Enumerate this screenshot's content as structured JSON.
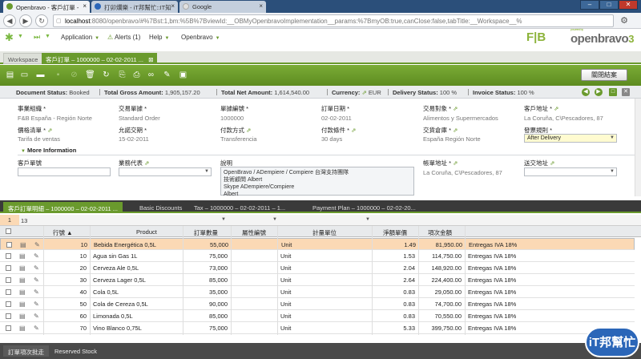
{
  "browser": {
    "tabs": [
      {
        "label": "Openbravo - 客戶訂單 -",
        "active": true
      },
      {
        "label": "打卯爛樂 - iT邦幫忙::IT知",
        "active": false
      },
      {
        "label": "Google",
        "active": false
      }
    ],
    "url_host": "localhost",
    "url_rest": ":8080/openbravo/#%7Bst:1,bm:%5B%7BviewId:__OBMyOpenbravoImplementation__params:%7BmyOB:true,canClose:false,tabTitle:__Workspace__%",
    "window_controls": [
      "–",
      "□",
      "✕"
    ]
  },
  "menu": {
    "items": [
      "Application",
      "Alerts (1)",
      "Help",
      "Openbravo"
    ]
  },
  "logo": {
    "left": "F|B",
    "right": "openbravo",
    "tagline": "powered by",
    "version": "3"
  },
  "window_tabs": [
    {
      "label": "Workspace",
      "active": false
    },
    {
      "label": "客戶訂單 – 1000000 – 02-02-2011 ...",
      "active": true
    }
  ],
  "toolbar": {
    "save_label": "關閉結案"
  },
  "status": {
    "doc_status_label": "Document Status:",
    "doc_status": "Booked",
    "gross_label": "Total Gross Amount:",
    "gross": "1,905,157.20",
    "net_label": "Total Net Amount:",
    "net": "1,614,540.00",
    "currency_label": "Currency:",
    "currency": "EUR",
    "delivery_label": "Delivery Status:",
    "delivery": "100 %",
    "invoice_label": "Invoice Status:",
    "invoice": "100 %"
  },
  "form": {
    "org_label": "事業組織",
    "org": "F&B España - Región Norte",
    "doctype_label": "交易單據",
    "doctype": "Standard Order",
    "docno_label": "單據編號",
    "docno": "1000000",
    "orderdate_label": "訂單日期",
    "orderdate": "02-02-2011",
    "bp_label": "交易對象",
    "bp": "Alimentos y Supermercados",
    "bpaddr_label": "客戶地址",
    "bpaddr": "La Coruña, C\\Pescadores, 87",
    "pricelist_label": "價格清單",
    "pricelist": "Tarifa de ventas",
    "delivdate_label": "允諾交期",
    "delivdate": "15-02-2011",
    "payment_label": "付款方式",
    "payment": "Transferencia",
    "payterm_label": "付款條件",
    "payterm": "30 days",
    "warehouse_label": "交貨倉庫",
    "warehouse": "España Región Norte",
    "invrule_label": "發票規則",
    "invrule": "After Delivery",
    "more_info": "More Information",
    "custref_label": "客戶單號",
    "salesrep_label": "業務代表",
    "desc_label": "說明",
    "desc_lines": [
      "OpenBravo / ADempiere / Compiere 台灣支持團隊",
      "技術顧問 Albert",
      "Skype ADempiere/Compiere",
      "Albert"
    ],
    "invaddr_label": "帳單地址",
    "invaddr": "La Coruña, C\\Pescadores, 87",
    "deladdr_label": "送交地址"
  },
  "subtabs": [
    {
      "label": "客戶訂單明細 – 1000000 – 02-02-2011 ...",
      "active": true
    },
    {
      "label": "Basic Discounts",
      "active": false
    },
    {
      "label": "Tax – 1000000 – 02-02-2011 – 1...",
      "active": false
    },
    {
      "label": "Payment Plan – 1000000 – 02-02-20...",
      "active": false
    }
  ],
  "grid": {
    "toolbar_a": "1",
    "toolbar_b": "13",
    "headers": [
      "行號 ▲",
      "Product",
      "訂單數量",
      "屬性編號",
      "計量單位",
      "淨額單價",
      "項次金額"
    ],
    "rows": [
      {
        "line": "10",
        "product": "Bebida Energética 0,5L",
        "qty": "55,000",
        "uom": "Unit",
        "price": "1.49",
        "amount": "81,950.00",
        "tax": "Entregas IVA 18%",
        "selected": true
      },
      {
        "line": "10",
        "product": "Agua sin Gas 1L",
        "qty": "75,000",
        "uom": "Unit",
        "price": "1.53",
        "amount": "114,750.00",
        "tax": "Entregas IVA 18%",
        "selected": false
      },
      {
        "line": "20",
        "product": "Cerveza Ale 0,5L",
        "qty": "73,000",
        "uom": "Unit",
        "price": "2.04",
        "amount": "148,920.00",
        "tax": "Entregas IVA 18%",
        "selected": false
      },
      {
        "line": "30",
        "product": "Cerveza Lager 0,5L",
        "qty": "85,000",
        "uom": "Unit",
        "price": "2.64",
        "amount": "224,400.00",
        "tax": "Entregas IVA 18%",
        "selected": false
      },
      {
        "line": "40",
        "product": "Cola 0,5L",
        "qty": "35,000",
        "uom": "Unit",
        "price": "0.83",
        "amount": "29,050.00",
        "tax": "Entregas IVA 18%",
        "selected": false
      },
      {
        "line": "50",
        "product": "Cola de Cereza 0,5L",
        "qty": "90,000",
        "uom": "Unit",
        "price": "0.83",
        "amount": "74,700.00",
        "tax": "Entregas IVA 18%",
        "selected": false
      },
      {
        "line": "60",
        "product": "Limonada 0,5L",
        "qty": "85,000",
        "uom": "Unit",
        "price": "0.83",
        "amount": "70,550.00",
        "tax": "Entregas IVA 18%",
        "selected": false
      },
      {
        "line": "70",
        "product": "Vino Blanco 0,75L",
        "qty": "75,000",
        "uom": "Unit",
        "price": "5.33",
        "amount": "399,750.00",
        "tax": "Entregas IVA 18%",
        "selected": false
      }
    ]
  },
  "bottom_tabs": [
    "訂單項次批走",
    "Reserved Stock"
  ],
  "watermark": "iT邦幫忙"
}
